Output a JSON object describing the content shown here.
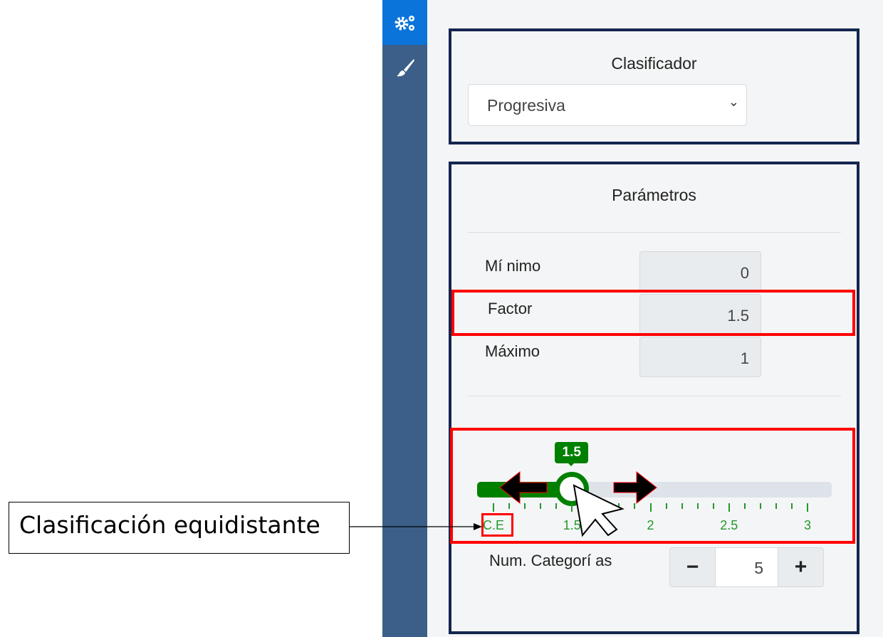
{
  "sidebar": {
    "items": [
      {
        "icon": "gears-icon",
        "active": true
      },
      {
        "icon": "paintbrush-icon",
        "active": false
      }
    ],
    "active_color": "#0a74da",
    "color": "#3b5f88"
  },
  "classifier": {
    "title": "Clasificador",
    "selected": "Progresiva"
  },
  "params": {
    "title": "Parámetros",
    "fields": [
      {
        "label": "Mí nimo",
        "value": "0"
      },
      {
        "label": "Factor",
        "value": "1.5"
      },
      {
        "label": "Máximo",
        "value": "1"
      }
    ]
  },
  "slider": {
    "value": 1.5,
    "value_label": "1.5",
    "min": 1,
    "max": 3,
    "step": 0.1,
    "color": "#008000",
    "tick_labels": [
      {
        "value": 1,
        "label": "C.E"
      },
      {
        "value": 1.5,
        "label": "1.5"
      },
      {
        "value": 2,
        "label": "2"
      },
      {
        "value": 2.5,
        "label": "2.5"
      },
      {
        "value": 3,
        "label": "3"
      }
    ]
  },
  "categories": {
    "label": "Num. Categorí as",
    "value": "5",
    "minus": "−",
    "plus": "+"
  },
  "annotation": {
    "text": "Clasificación equidistante"
  }
}
